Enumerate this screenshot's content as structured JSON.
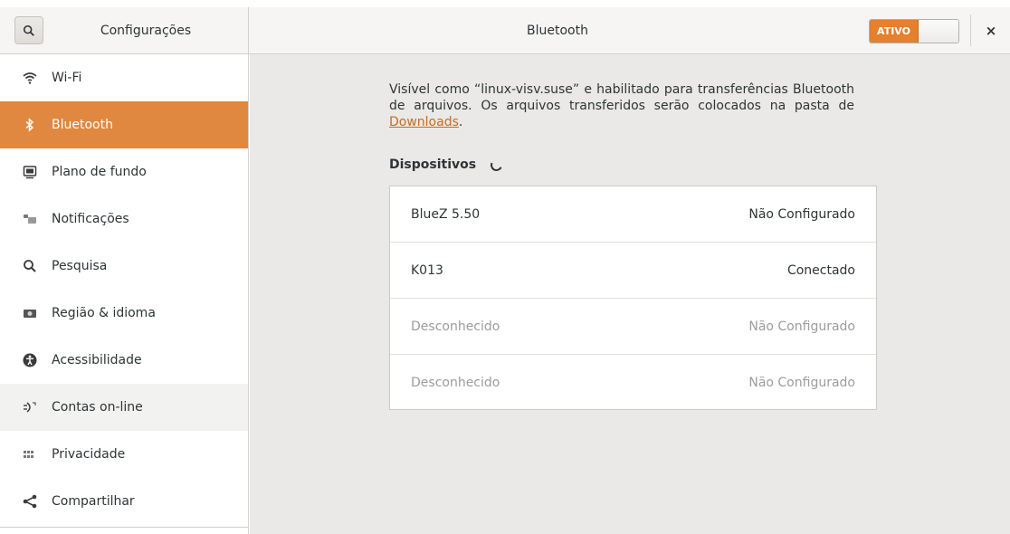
{
  "header": {
    "sidebar_title": "Configurações",
    "title": "Bluetooth",
    "switch_label": "ATIVO",
    "close_glyph": "×"
  },
  "sidebar": {
    "items": [
      {
        "label": "Wi-Fi",
        "icon": "wifi-icon"
      },
      {
        "label": "Bluetooth",
        "icon": "bluetooth-icon",
        "active": true
      },
      {
        "label": "Plano de fundo",
        "icon": "background-icon"
      },
      {
        "label": "Notificações",
        "icon": "notifications-icon"
      },
      {
        "label": "Pesquisa",
        "icon": "search-icon"
      },
      {
        "label": "Região & idioma",
        "icon": "region-icon"
      },
      {
        "label": "Acessibilidade",
        "icon": "accessibility-icon"
      },
      {
        "label": "Contas on-line",
        "icon": "online-accounts-icon"
      },
      {
        "label": "Privacidade",
        "icon": "privacy-icon"
      },
      {
        "label": "Compartilhar",
        "icon": "share-icon"
      }
    ]
  },
  "main": {
    "description_part1": "Visível como “linux-visv.suse” e habilitado para transferências Bluetooth de arquivos. Os arquivos transferidos serão colocados na pasta de ",
    "downloads_link": "Downloads",
    "description_part2": ".",
    "devices_heading": "Dispositivos",
    "devices": [
      {
        "name": "BlueZ 5.50",
        "status": "Não Configurado",
        "dimmed": false
      },
      {
        "name": "K013",
        "status": "Conectado",
        "dimmed": false
      },
      {
        "name": "Desconhecido",
        "status": "Não Configurado",
        "dimmed": true
      },
      {
        "name": "Desconhecido",
        "status": "Não Configurado",
        "dimmed": true
      }
    ]
  },
  "colors": {
    "accent": "#e0883f",
    "switch_on": "#e4802e",
    "link": "#c46d1f",
    "content_bg": "#eae9e7"
  }
}
